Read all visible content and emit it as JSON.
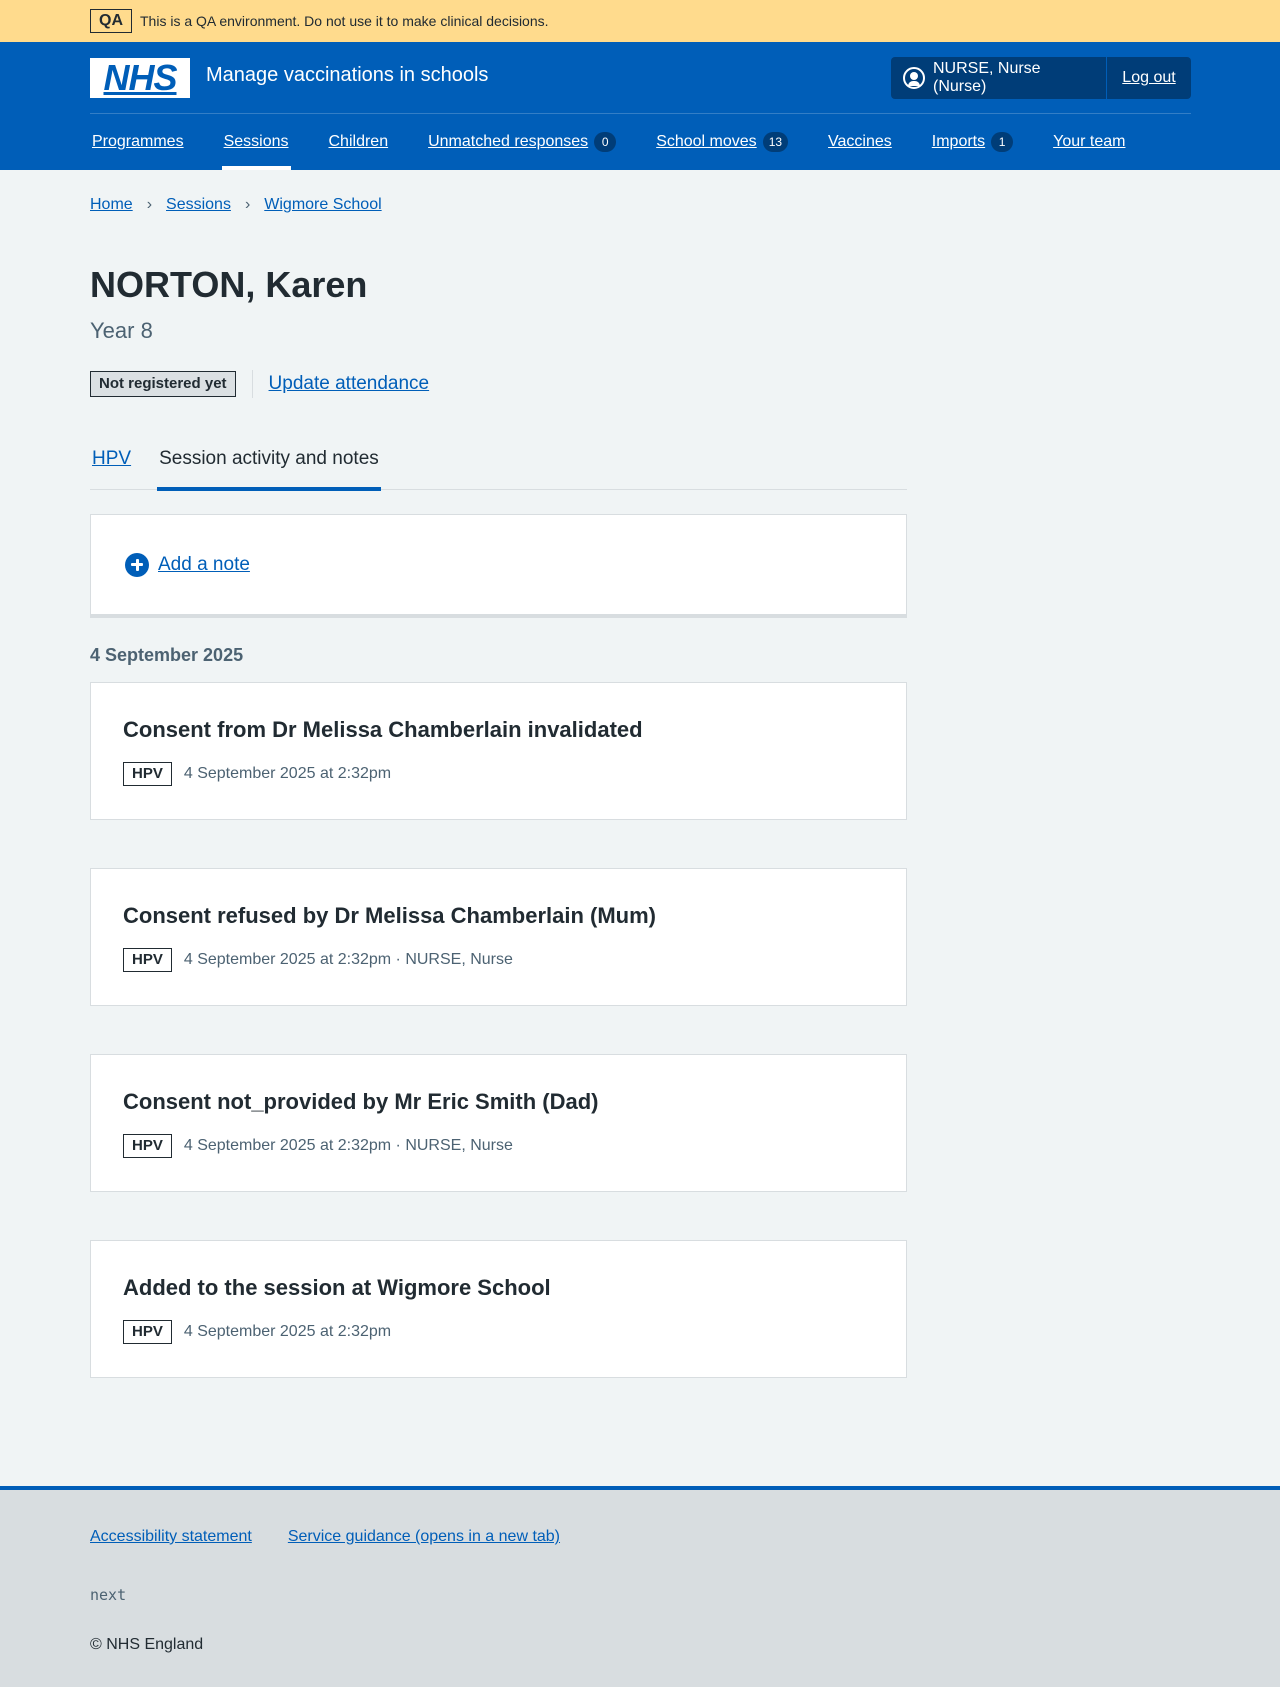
{
  "qa_banner": {
    "tag": "QA",
    "text": "This is a QA environment. Do not use it to make clinical decisions."
  },
  "header": {
    "logo_text": "NHS",
    "service_name": "Manage vaccinations in schools",
    "user": "NURSE, Nurse (Nurse)",
    "logout": "Log out",
    "nav": [
      {
        "label": "Programmes"
      },
      {
        "label": "Sessions",
        "active": true
      },
      {
        "label": "Children"
      },
      {
        "label": "Unmatched responses",
        "count": "0"
      },
      {
        "label": "School moves",
        "count": "13"
      },
      {
        "label": "Vaccines"
      },
      {
        "label": "Imports",
        "count": "1"
      },
      {
        "label": "Your team"
      }
    ]
  },
  "breadcrumb": [
    "Home",
    "Sessions",
    "Wigmore School"
  ],
  "patient": {
    "name": "NORTON, Karen",
    "year": "Year 8",
    "status": "Not registered yet",
    "update_attendance": "Update attendance"
  },
  "tabs": [
    {
      "label": "HPV",
      "active": false
    },
    {
      "label": "Session activity and notes",
      "active": true
    }
  ],
  "add_note": "Add a note",
  "date_heading": "4 September 2025",
  "events": [
    {
      "title": "Consent from Dr Melissa Chamberlain invalidated",
      "programme": "HPV",
      "meta": "4 September 2025 at 2:32pm"
    },
    {
      "title": "Consent refused by Dr Melissa Chamberlain (Mum)",
      "programme": "HPV",
      "meta": "4 September 2025 at 2:32pm · NURSE, Nurse"
    },
    {
      "title": "Consent not_provided by Mr Eric Smith (Dad)",
      "programme": "HPV",
      "meta": "4 September 2025 at 2:32pm · NURSE, Nurse"
    },
    {
      "title": "Added to the session at Wigmore School",
      "programme": "HPV",
      "meta": "4 September 2025 at 2:32pm"
    }
  ],
  "footer": {
    "links": [
      "Accessibility statement",
      "Service guidance (opens in a new tab)"
    ],
    "version": "next",
    "copyright": "© NHS England"
  },
  "colors": {
    "nhs_blue": "#005eb8",
    "nhs_dark_blue": "#003d78",
    "qa_banner": "#ffdb8d",
    "page_background": "#f0f4f5",
    "footer_background": "#d8dde0"
  }
}
